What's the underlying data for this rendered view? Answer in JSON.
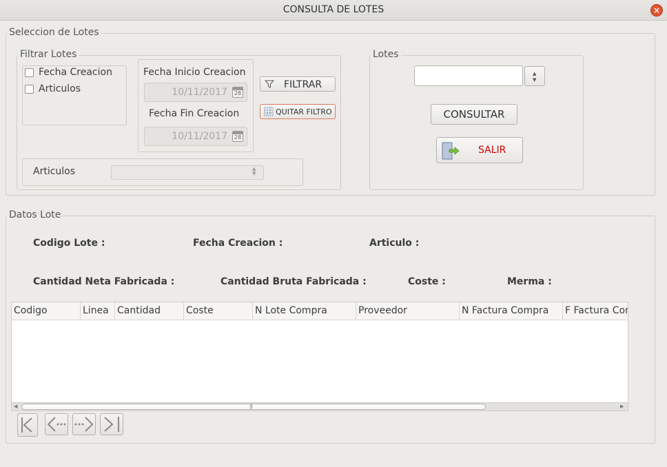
{
  "window": {
    "title": "CONSULTA DE LOTES",
    "close_label": "×"
  },
  "seleccion": {
    "legend": "Seleccion de Lotes",
    "filtrar": {
      "legend": "Filtrar Lotes",
      "checkboxes": [
        {
          "label": "Fecha Creacion"
        },
        {
          "label": "Articulos"
        }
      ],
      "fecha_inicio_label": "Fecha Inicio Creacion",
      "fecha_inicio_value": "10/11/2017",
      "fecha_fin_label": "Fecha Fin Creacion",
      "fecha_fin_value": "10/11/2017",
      "calendar_day": "28",
      "filtrar_button": "FILTRAR",
      "quitar_filtro_button": "QUITAR FILTRO",
      "articulos_label": "Articulos",
      "articulos_value": ""
    },
    "lotes": {
      "legend": "Lotes",
      "input_value": "",
      "consultar_button": "CONSULTAR",
      "salir_button": "SALIR"
    }
  },
  "datos": {
    "legend": "Datos Lote",
    "fields": {
      "codigo_lote": "Codigo Lote :",
      "fecha_creacion": "Fecha Creacion :",
      "articulo": "Articulo :",
      "cantidad_neta": "Cantidad Neta Fabricada :",
      "cantidad_bruta": "Cantidad Bruta Fabricada :",
      "coste": "Coste :",
      "merma": "Merma :"
    },
    "table": {
      "columns": [
        "Codigo",
        "Linea",
        "Cantidad",
        "Coste",
        "N Lote Compra",
        "Proveedor",
        "N Factura Compra",
        "F Factura Com"
      ],
      "rows": []
    }
  },
  "colors": {
    "background": "#edebe8",
    "close_button": "#e2552f",
    "salir_text": "#cc0000",
    "quitar_border": "#e07a5f"
  },
  "icons": {
    "filter": "funnel-icon",
    "quitar": "grid-icon",
    "salir": "exit-door-icon",
    "calendar": "calendar-icon"
  }
}
